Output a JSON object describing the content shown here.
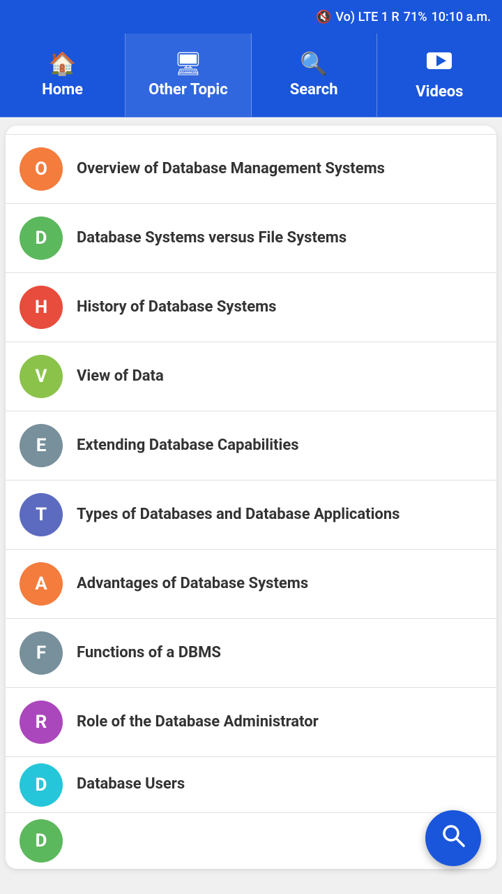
{
  "statusBar": {
    "time": "10:10 a.m.",
    "battery": "71%",
    "signal": "LTE"
  },
  "nav": {
    "items": [
      {
        "id": "home",
        "label": "Home",
        "icon": "🏠"
      },
      {
        "id": "other-topic",
        "label": "Other Topic",
        "icon": "🖥",
        "active": true
      },
      {
        "id": "search",
        "label": "Search",
        "icon": "🔍"
      },
      {
        "id": "videos",
        "label": "Videos",
        "icon": "▶"
      }
    ]
  },
  "list": {
    "items": [
      {
        "id": 1,
        "letter": "O",
        "text": "Overview of Database Management Systems",
        "color": "#f47c3c"
      },
      {
        "id": 2,
        "letter": "D",
        "text": "Database Systems versus File Systems",
        "color": "#5cb85c"
      },
      {
        "id": 3,
        "letter": "H",
        "text": "History of Database Systems",
        "color": "#e74c3c"
      },
      {
        "id": 4,
        "letter": "V",
        "text": "View of Data",
        "color": "#8bc34a"
      },
      {
        "id": 5,
        "letter": "E",
        "text": "Extending Database Capabilities",
        "color": "#78909c"
      },
      {
        "id": 6,
        "letter": "T",
        "text": "Types of Databases and Database Applications",
        "color": "#5c6bc0"
      },
      {
        "id": 7,
        "letter": "A",
        "text": "Advantages of Database Systems",
        "color": "#f47c3c"
      },
      {
        "id": 8,
        "letter": "F",
        "text": "Functions of a DBMS",
        "color": "#78909c"
      },
      {
        "id": 9,
        "letter": "R",
        "text": "Role of the Database Administrator",
        "color": "#ab47bc"
      },
      {
        "id": 10,
        "letter": "D",
        "text": "Database Users",
        "color": "#26c6da"
      }
    ]
  },
  "fab": {
    "icon": "search",
    "ariaLabel": "Search"
  }
}
